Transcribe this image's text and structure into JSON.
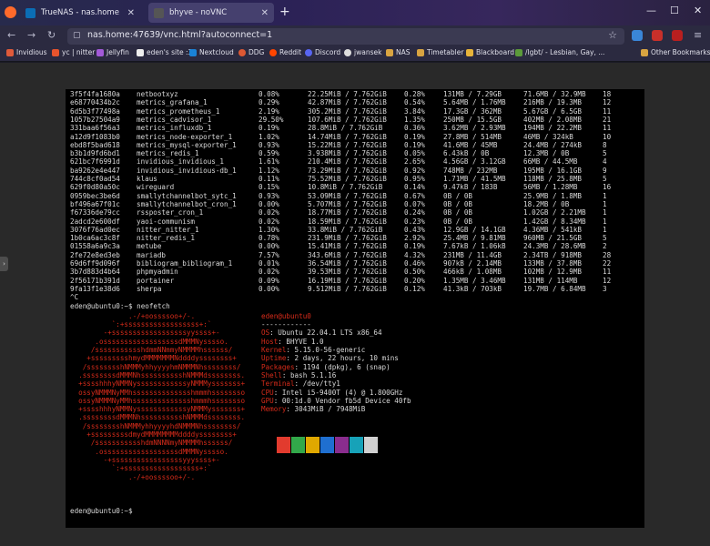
{
  "browser": {
    "tabs": [
      {
        "label": "TrueNAS - nas.home",
        "active": false
      },
      {
        "label": "bhyve - noVNC",
        "active": true
      }
    ],
    "url": "nas.home:47639/vnc.html?autoconnect=1",
    "bookmarks": [
      "Invidious",
      "yc | nitter",
      "Jellyfin",
      "eden's site :3",
      "Nextcloud",
      "DDG",
      "Reddit",
      "Discord",
      "jwansek",
      "NAS",
      "Timetabler",
      "Blackboard",
      "/lgbt/ - Lesbian, Gay, ...",
      "Other Bookmarks"
    ]
  },
  "terminal": {
    "stats": [
      [
        "3f5f4fa1680a",
        "netbootxyz",
        "0.08%",
        "22.25MiB / 7.762GiB",
        "0.28%",
        "131MB / 7.29GB",
        "71.6MB / 32.9MB",
        "18"
      ],
      [
        "e68770434b2c",
        "metrics_grafana_1",
        "0.29%",
        "42.87MiB / 7.762GiB",
        "0.54%",
        "5.64MB / 1.76MB",
        "216MB / 19.3MB",
        "12"
      ],
      [
        "6d5b3f77498a",
        "metrics_prometheus_1",
        "2.19%",
        "305.2MiB / 7.762GiB",
        "3.84%",
        "17.3GB / 362MB",
        "5.67GB / 6.5GB",
        "11"
      ],
      [
        "1057b27504a9",
        "metrics_cadvisor_1",
        "29.50%",
        "107.6MiB / 7.762GiB",
        "1.35%",
        "250MB / 15.5GB",
        "402MB / 2.08MB",
        "21"
      ],
      [
        "331baa6f56a3",
        "metrics_influxdb_1",
        "0.19%",
        "28.8MiB / 7.762GiB",
        "0.36%",
        "3.62MB / 2.93MB",
        "194MB / 22.2MB",
        "11"
      ],
      [
        "a12d9f1083b0",
        "metrics_node-exporter_1",
        "1.02%",
        "14.74MiB / 7.762GiB",
        "0.19%",
        "27.8MB / 514MB",
        "46MB / 324kB",
        "10"
      ],
      [
        "ebd8f5bad618",
        "metrics_mysql-exporter_1",
        "0.93%",
        "15.22MiB / 7.762GiB",
        "0.19%",
        "41.6MB / 45MB",
        "24.4MB / 274kB",
        "8"
      ],
      [
        "b3b1d9fd6bd1",
        "metrics_redis_1",
        "0.59%",
        "3.938MiB / 7.762GiB",
        "0.05%",
        "6.43kB / 0B",
        "12.3MB / 0B",
        "5"
      ],
      [
        "621bc7f6991d",
        "invidious_invidious_1",
        "1.61%",
        "210.4MiB / 7.762GiB",
        "2.65%",
        "4.56GB / 3.12GB",
        "66MB / 44.5MB",
        "4"
      ],
      [
        "ba9262e4e447",
        "invidious_invidious-db_1",
        "1.12%",
        "73.29MiB / 7.762GiB",
        "0.92%",
        "748MB / 232MB",
        "195MB / 16.1GB",
        "9"
      ],
      [
        "744c8cf0ad54",
        "klaus",
        "0.11%",
        "75.52MiB / 7.762GiB",
        "0.95%",
        "1.71MB / 41.5MB",
        "118MB / 25.8MB",
        "5"
      ],
      [
        "629f0d80a50c",
        "wireguard",
        "0.15%",
        "10.8MiB / 7.762GiB",
        "0.14%",
        "9.47kB / 183B",
        "56MB / 1.28MB",
        "16"
      ],
      [
        "0959bec3be6d",
        "smallytchannelbot_sytc_1",
        "0.93%",
        "53.09MiB / 7.762GiB",
        "0.67%",
        "0B / 0B",
        "25.9MB / 1.8MB",
        "1"
      ],
      [
        "bf496a67f01c",
        "smallytchannelbot_cron_1",
        "0.00%",
        "5.707MiB / 7.762GiB",
        "0.07%",
        "0B / 0B",
        "18.2MB / 0B",
        "1"
      ],
      [
        "f67336de79cc",
        "rssposter_cron_1",
        "0.02%",
        "18.77MiB / 7.762GiB",
        "0.24%",
        "0B / 0B",
        "1.02GB / 2.21MB",
        "1"
      ],
      [
        "2adcd2e600df",
        "yaoi-communism",
        "0.02%",
        "18.59MiB / 7.762GiB",
        "0.23%",
        "0B / 0B",
        "1.42GB / 8.34MB",
        "1"
      ],
      [
        "3076f76ad0ec",
        "nitter_nitter_1",
        "1.30%",
        "33.8MiB / 7.762GiB",
        "0.43%",
        "12.9GB / 14.1GB",
        "4.36MB / 541kB",
        "1"
      ],
      [
        "1b0ca6ac3c8f",
        "nitter_redis_1",
        "0.78%",
        "231.9MiB / 7.762GiB",
        "2.92%",
        "25.4MB / 9.81MB",
        "960MB / 21.5GB",
        "5"
      ],
      [
        "01558a6a9c3a",
        "metube",
        "0.00%",
        "15.41MiB / 7.762GiB",
        "0.19%",
        "7.67kB / 1.06kB",
        "24.3MB / 28.6MB",
        "2"
      ],
      [
        "2fe72e8ed3eb",
        "mariadb",
        "7.57%",
        "343.6MiB / 7.762GiB",
        "4.32%",
        "231MB / 11.4GB",
        "2.34TB / 918MB",
        "28"
      ],
      [
        "69d6ff9d096f",
        "bibliogram_bibliogram_1",
        "0.01%",
        "36.54MiB / 7.762GiB",
        "0.46%",
        "907kB / 2.14MB",
        "133MB / 37.8MB",
        "22"
      ],
      [
        "3b7d883d4b64",
        "phpmyadmin",
        "0.02%",
        "39.53MiB / 7.762GiB",
        "0.50%",
        "466kB / 1.08MB",
        "102MB / 12.9MB",
        "11"
      ],
      [
        "2f56171b391d",
        "portainer",
        "0.09%",
        "16.19MiB / 7.762GiB",
        "0.20%",
        "1.35MB / 3.46MB",
        "131MB / 114MB",
        "12"
      ],
      [
        "9fa13f1e38d6",
        "sherpa",
        "0.00%",
        "9.512MiB / 7.762GiB",
        "0.12%",
        "41.3kB / 703kB",
        "19.7MB / 6.84MB",
        "3"
      ]
    ],
    "interrupt": "^C",
    "prompt1": "eden@ubuntu0:~$ neofetch",
    "logo": [
      "              .-/+oossssoo+/-.",
      "          `:+ssssssssssssssssss+:`",
      "        -+ssssssssssssssssssyyssss+-",
      "      .ossssssssssssssssssdMMMNysssso.",
      "     /ssssssssssshdmmNNmmyNMMMMhssssss/",
      "    +ssssssssshmydMMMMMMMNddddyssssssss+",
      "   /sssssssshNMMMyhhyyyyhmNMMMNhssssssss/",
      "  .ssssssssdMMMNhsssssssssshNMMMdssssssss.",
      "  +sssshhhyNMMNyssssssssssssyNMMMysssssss+",
      "  ossyNMMMNyMMhsssssssssssssshmmmhssssssso",
      "  ossyNMMMNyMMhsssssssssssssshmmmhssssssso",
      "  +sssshhhyNMMNyssssssssssssyNMMMysssssss+",
      "  .ssssssssdMMMNhsssssssssshNMMMdssssssss.",
      "   /sssssssshNMMMyhhyyyyhdNMMMNhssssssss/",
      "    +sssssssssdmydMMMMMMMMddddyssssssss+",
      "     /ssssssssssshdmNNNNmyNMMMMhssssss/",
      "      .ossssssssssssssssssdMMMNysssso.",
      "        -+sssssssssssssssssyyyssss+-",
      "          `:+ssssssssssssssssss+:`",
      "              .-/+oossssoo+/-."
    ],
    "userhost": "eden@ubuntu0",
    "separator": "------------",
    "info": [
      {
        "label": "OS",
        "value": "Ubuntu 22.04.1 LTS x86_64"
      },
      {
        "label": "Host",
        "value": "BHYVE 1.0"
      },
      {
        "label": "Kernel",
        "value": "5.15.0-56-generic"
      },
      {
        "label": "Uptime",
        "value": "2 days, 22 hours, 10 mins"
      },
      {
        "label": "Packages",
        "value": "1194 (dpkg), 6 (snap)"
      },
      {
        "label": "Shell",
        "value": "bash 5.1.16"
      },
      {
        "label": "Terminal",
        "value": "/dev/tty1"
      },
      {
        "label": "CPU",
        "value": "Intel i5-9400T (4) @ 1.800GHz"
      },
      {
        "label": "GPU",
        "value": "00:1d.0 Vendor fb5d Device 40fb"
      },
      {
        "label": "Memory",
        "value": "3043MiB / 7948MiB"
      }
    ],
    "palette": [
      "#000000",
      "#e23b2e",
      "#32a84a",
      "#e0a800",
      "#1f6fd0",
      "#8a2d8e",
      "#17a2b8",
      "#d0d0d0"
    ],
    "prompt2": "eden@ubuntu0:~$"
  }
}
